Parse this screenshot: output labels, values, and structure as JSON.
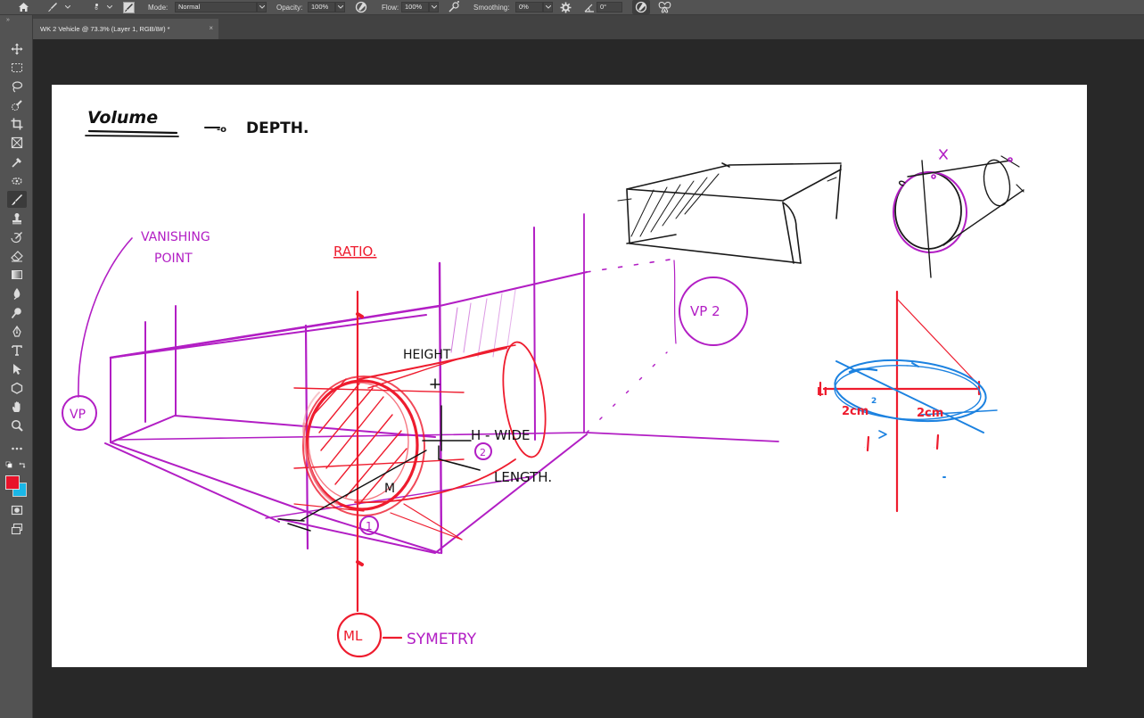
{
  "options_bar": {
    "brush_size": "6",
    "mode_label": "Mode:",
    "mode_value": "Normal",
    "opacity_label": "Opacity:",
    "opacity_value": "100%",
    "flow_label": "Flow:",
    "flow_value": "100%",
    "smoothing_label": "Smoothing:",
    "smoothing_value": "0%",
    "angle_value": "0°"
  },
  "document_tab": {
    "title": "WK 2 Vehicle @ 73.3% (Layer 1, RGB/8#) *",
    "close": "×"
  },
  "toolbar": {
    "collapse": "»",
    "tools": [
      "move-tool",
      "marquee-tool",
      "lasso-tool",
      "quick-select-tool",
      "crop-tool",
      "frame-tool",
      "eyedropper-tool",
      "spot-heal-tool",
      "brush-tool",
      "stamp-tool",
      "history-brush-tool",
      "eraser-tool",
      "gradient-tool",
      "blur-tool",
      "dodge-tool",
      "pen-tool",
      "type-tool",
      "path-select-tool",
      "shape-tool",
      "hand-tool",
      "zoom-tool",
      "more-tools"
    ],
    "foreground_color": "#e8132a",
    "background_color": "#1ab7e8"
  },
  "canvas_annotations": {
    "title": "Volume",
    "title_arrow": "-o",
    "title_depth": "DEPTH.",
    "vanishing_point": "VANISHING POINT",
    "vp": "VP",
    "ratio": "RATIO.",
    "vp2": "VP 2",
    "height": "HEIGHT",
    "h_wide": "H - WIDE",
    "wide_marker": "2",
    "length": "LENGTH.",
    "m": "M",
    "circle_one": "1",
    "ml": "ML",
    "symmetry": "SYMETRY",
    "cyl_x": "x",
    "ell_2cm_left": "2cm",
    "ell_2cm_right": "2cm",
    "ell_1_left": "1",
    "ell_1_right": "1",
    "ell_2_small": "2",
    "ell_left_mark": "LI"
  },
  "colors": {
    "purple": "#b21ec4",
    "red": "#ee1c2e",
    "blue": "#1c82e0",
    "ink": "#1a1a1a"
  }
}
